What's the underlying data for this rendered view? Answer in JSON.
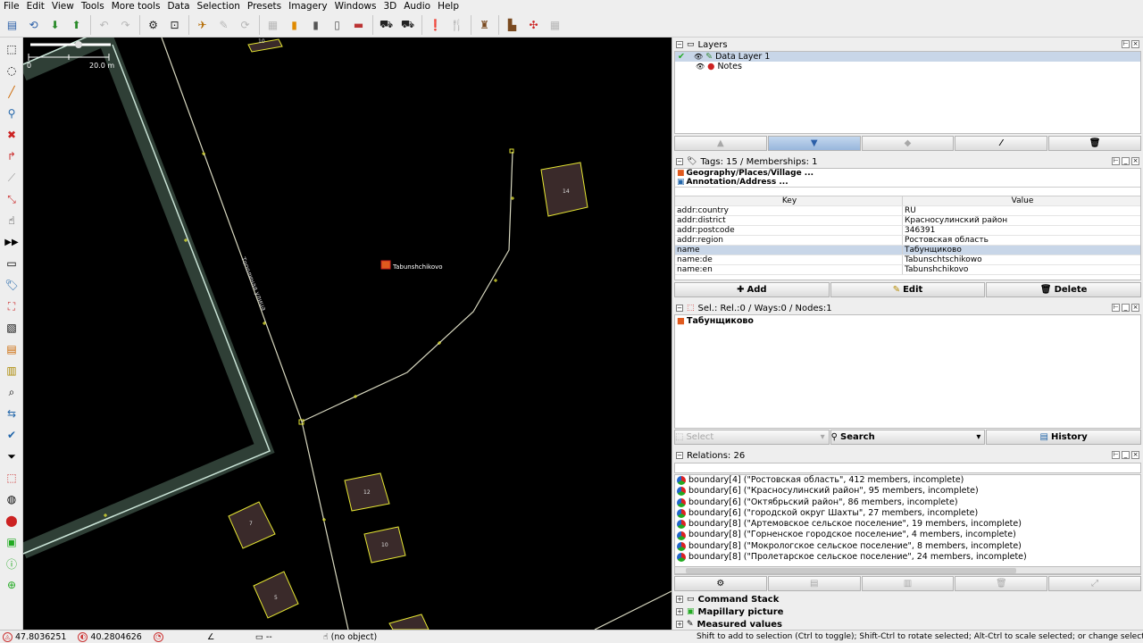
{
  "menubar": {
    "items": [
      "File",
      "Edit",
      "View",
      "Tools",
      "More tools",
      "Data",
      "Selection",
      "Presets",
      "Imagery",
      "Windows",
      "3D",
      "Audio",
      "Help"
    ]
  },
  "toolbar": {
    "icons": [
      "open-icon",
      "save-icon",
      "download-icon",
      "upload-icon",
      "undo-icon",
      "redo-icon",
      "preferences-icon",
      "zoom-icon",
      "wireframe-icon",
      "select-icon",
      "refresh-icon",
      "blank-icon",
      "traffic-signal-icon",
      "railway-icon",
      "power-icon",
      "wall-icon",
      "car-icon",
      "bus-icon",
      "warning-icon",
      "restaurant-icon",
      "castle-icon",
      "industry-icon",
      "node-grid-icon",
      "disabled-icon"
    ]
  },
  "map": {
    "scale": {
      "start": "0",
      "end": "20.0 m"
    },
    "road_label": "Тополиная улица",
    "place_label": "Tabunshchikovo",
    "house_numbers": [
      "14",
      "12",
      "10",
      "7",
      "5",
      "10"
    ]
  },
  "layers": {
    "title": "Layers",
    "items": [
      {
        "name": "Data Layer 1",
        "active": true
      },
      {
        "name": "Notes",
        "active": false
      }
    ]
  },
  "tags": {
    "title": "Tags: 15 / Memberships: 1",
    "presets": [
      "Geography/Places/Village ...",
      "Annotation/Address ..."
    ],
    "columns": {
      "key": "Key",
      "value": "Value"
    },
    "rows": [
      {
        "k": "addr:country",
        "v": "RU"
      },
      {
        "k": "addr:district",
        "v": "Красносулинский район"
      },
      {
        "k": "addr:postcode",
        "v": "346391"
      },
      {
        "k": "addr:region",
        "v": "Ростовская область"
      },
      {
        "k": "name",
        "v": "Табунщиково"
      },
      {
        "k": "name:de",
        "v": "Tabunschtschikowo"
      },
      {
        "k": "name:en",
        "v": "Tabunshchikovo"
      }
    ],
    "buttons": {
      "add": "Add",
      "edit": "Edit",
      "delete": "Delete"
    }
  },
  "selection": {
    "title": "Sel.: Rel.:0 / Ways:0 / Nodes:1",
    "items": [
      "Табунщиково"
    ],
    "buttons": {
      "select": "Select",
      "search": "Search",
      "history": "History"
    }
  },
  "relations": {
    "title": "Relations: 26",
    "items": [
      "boundary[4] (\"Ростовская область\", 412 members, incomplete)",
      "boundary[6] (\"Красносулинский район\", 95 members, incomplete)",
      "boundary[6] (\"Октябрьский район\", 86 members, incomplete)",
      "boundary[6] (\"городской округ Шахты\", 27 members, incomplete)",
      "boundary[8] (\"Артемовское сельское поселение\", 19 members, incomplete)",
      "boundary[8] (\"Горненское городское поселение\", 4 members, incomplete)",
      "boundary[8] (\"Мокрологское сельское поселение\", 8 members, incomplete)",
      "boundary[8] (\"Пролетарское сельское поселение\", 24 members, incomplete)"
    ]
  },
  "collapsed_panels": [
    "Command Stack",
    "Mapillary picture",
    "Measured values"
  ],
  "statusbar": {
    "lat": "47.8036251",
    "lon": "40.2804626",
    "angle": "",
    "heading": "",
    "length": "--",
    "object": "(no object)",
    "help": "Shift to add to selection (Ctrl to toggle); Shift-Ctrl to rotate selected; Alt-Ctrl to scale selected; or change selection"
  },
  "colors": {
    "map_bg": "#000000",
    "boundary": "#2f3f36",
    "boundary_edge": "#c9e3d6",
    "way": "#d8d8c0",
    "node": "#e6e633",
    "building": "#3a2a2a",
    "selection_blue": "#c8d6e8",
    "accent_button": "#98b6dc"
  }
}
